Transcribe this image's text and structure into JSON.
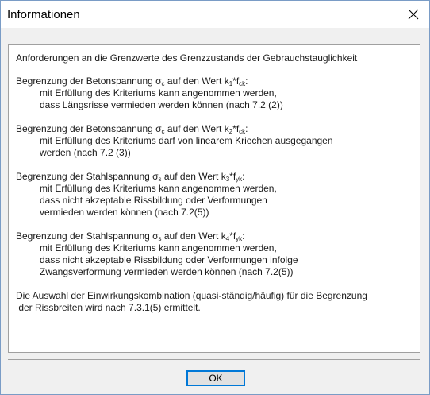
{
  "window": {
    "title": "Informationen",
    "close_icon": "close-x-icon"
  },
  "content": {
    "header": "Anforderungen an die Grenzwerte des Grenzzustands der Gebrauchstauglichkeit",
    "sections": [
      {
        "title": {
          "pre": "Begrenzung der Betonspannung σ",
          "sub1": "c",
          "mid": " auf den Wert k",
          "sub2": "1",
          "mid2": "*f",
          "sub3": "ck",
          "post": ":"
        },
        "lines": [
          "mit Erfüllung des Kriteriums kann angenommen werden,",
          "dass Längsrisse vermieden werden können (nach 7.2 (2))"
        ]
      },
      {
        "title": {
          "pre": "Begrenzung der Betonspannung σ",
          "sub1": "c",
          "mid": " auf den Wert k",
          "sub2": "2",
          "mid2": "*f",
          "sub3": "ck",
          "post": ":"
        },
        "lines": [
          "mit Erfüllung des Kriteriums darf von linearem Kriechen ausgegangen",
          "werden (nach 7.2 (3))"
        ]
      },
      {
        "title": {
          "pre": "Begrenzung der Stahlspannung σ",
          "sub1": "s",
          "mid": " auf den Wert k",
          "sub2": "3",
          "mid2": "*f",
          "sub3": "yk",
          "post": ":"
        },
        "lines": [
          "mit Erfüllung des Kriteriums kann angenommen werden,",
          "dass nicht akzeptable Rissbildung oder Verformungen",
          "vermieden werden können (nach 7.2(5))"
        ]
      },
      {
        "title": {
          "pre": "Begrenzung der Stahlspannung σ",
          "sub1": "s",
          "mid": " auf den Wert k",
          "sub2": "4",
          "mid2": "*f",
          "sub3": "yk",
          "post": ":"
        },
        "lines": [
          "mit Erfüllung des Kriteriums kann angenommen werden,",
          "dass nicht akzeptable Rissbildung oder Verformungen infolge",
          "Zwangsverformung vermieden werden können (nach 7.2(5))"
        ]
      }
    ],
    "footer_lines": [
      "Die Auswahl der Einwirkungskombination (quasi-ständig/häufig) für die Begrenzung",
      " der Rissbreiten wird nach 7.3.1(5) ermittelt."
    ]
  },
  "buttons": {
    "ok_label": "OK"
  },
  "colors": {
    "accent": "#0078d7",
    "window_border": "#7a9cc6",
    "dialog_background": "#f0f0f0"
  }
}
